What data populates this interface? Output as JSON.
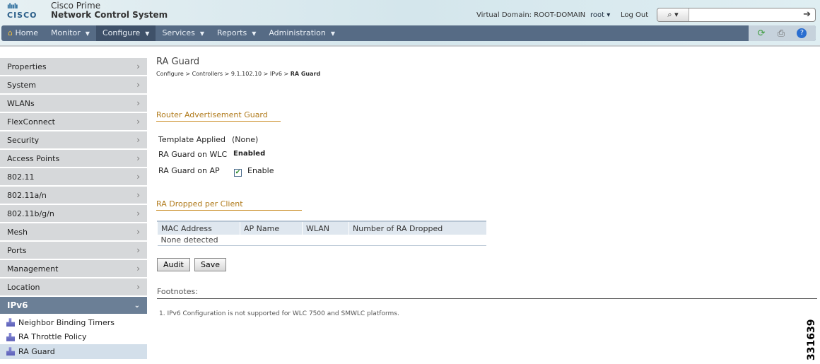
{
  "header": {
    "logo_bars": "ılıılı",
    "logo_word": "CISCO",
    "product_line1": "Cisco Prime",
    "product_line2": "Network Control System",
    "virtual_domain": "Virtual Domain: ROOT-DOMAIN",
    "user": "root ▾",
    "logout": "Log Out",
    "search_placeholder": ""
  },
  "nav": {
    "items": [
      {
        "label": "Home"
      },
      {
        "label": "Monitor"
      },
      {
        "label": "Configure"
      },
      {
        "label": "Services"
      },
      {
        "label": "Reports"
      },
      {
        "label": "Administration"
      }
    ]
  },
  "sidebar": {
    "items": [
      "Properties",
      "System",
      "WLANs",
      "FlexConnect",
      "Security",
      "Access Points",
      "802.11",
      "802.11a/n",
      "802.11b/g/n",
      "Mesh",
      "Ports",
      "Management",
      "Location"
    ],
    "open": "IPv6",
    "sub": [
      "Neighbor Binding Timers",
      "RA Throttle Policy",
      "RA Guard"
    ]
  },
  "page": {
    "title": "RA Guard",
    "breadcrumb": "Configure > Controllers > 9.1.102.10 > IPv6 > ",
    "breadcrumb_current": "RA Guard",
    "section1": "Router Advertisement Guard",
    "template_label": "Template Applied",
    "template_value": "(None)",
    "wlc_label": "RA Guard on WLC",
    "wlc_value": "Enabled",
    "ap_label": "RA Guard on AP",
    "ap_checkbox": "Enable",
    "ap_checked": true,
    "section2": "RA Dropped per Client",
    "columns": [
      "MAC Address",
      "AP Name",
      "WLAN",
      "Number of RA Dropped"
    ],
    "empty": "None detected",
    "audit": "Audit",
    "save": "Save",
    "footnotes": "Footnotes:",
    "footnote1": "1. IPv6 Configuration is not supported for WLC 7500 and SMWLC platforms."
  },
  "figure_number": "331639"
}
